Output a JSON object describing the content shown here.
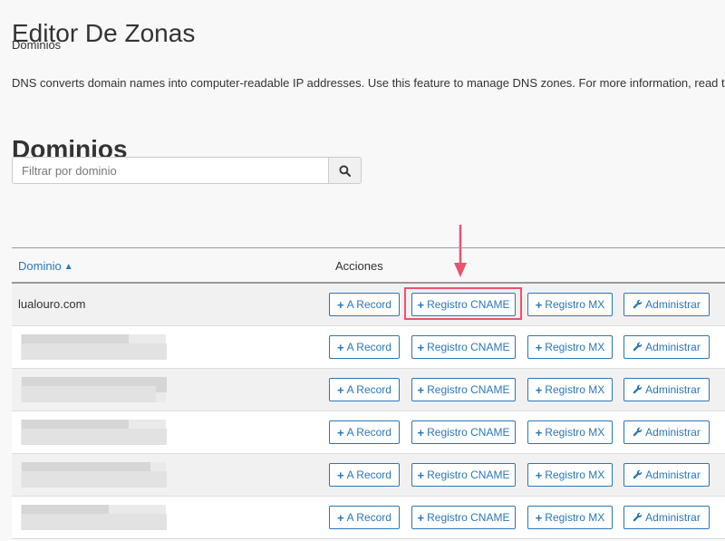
{
  "page": {
    "title": "Editor De Zonas",
    "breadcrumb": "Dominios",
    "description": "DNS converts domain names into computer-readable IP addresses. Use this feature to manage DNS zones. For more information, read the documentation."
  },
  "section": {
    "title": "Dominios"
  },
  "filter": {
    "placeholder": "Filtrar por dominio",
    "value": ""
  },
  "table": {
    "col_domain": "Dominio",
    "col_actions": "Acciones",
    "rows": [
      {
        "domain": "lualouro.com"
      },
      {
        "domain": ""
      },
      {
        "domain": ""
      },
      {
        "domain": ""
      },
      {
        "domain": ""
      },
      {
        "domain": ""
      }
    ]
  },
  "actions": {
    "a_record": "A Record",
    "cname": "Registro CNAME",
    "mx": "Registro MX",
    "admin": "Administrar"
  },
  "colors": {
    "link": "#2a77b8",
    "highlight": "#e8546a"
  },
  "icons": {
    "search": "search-icon",
    "plus": "plus-icon",
    "wrench": "wrench-icon",
    "sort_up": "chevron-up-icon"
  }
}
